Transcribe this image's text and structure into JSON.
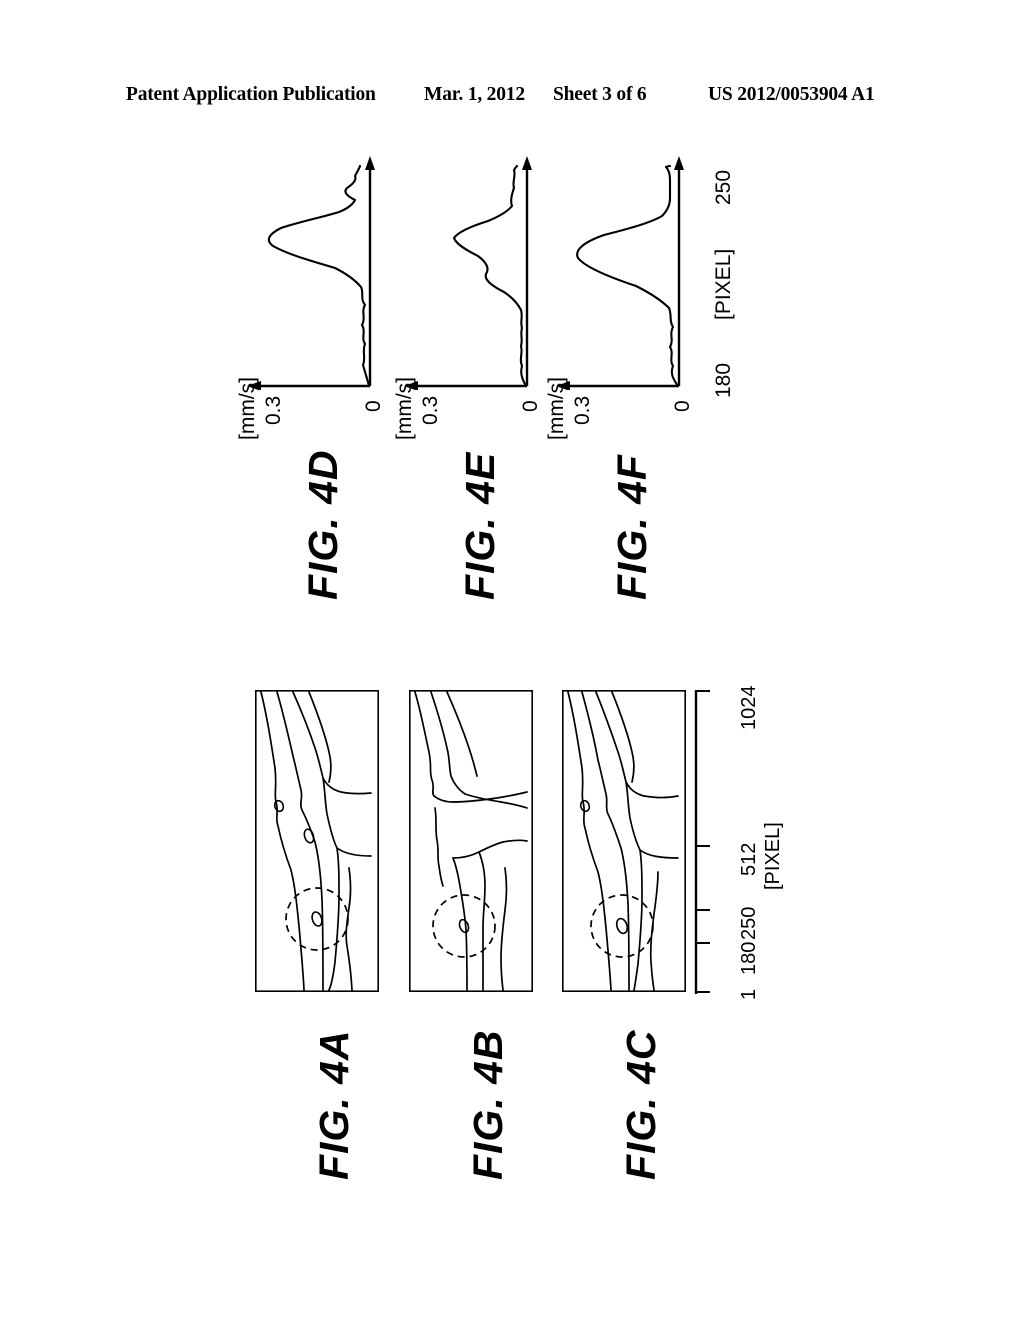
{
  "header": {
    "publication": "Patent Application Publication",
    "date": "Mar. 1, 2012",
    "sheet": "Sheet 3 of 6",
    "number": "US 2012/0053904 A1"
  },
  "figures": {
    "fig4a": {
      "label": "FIG. 4A"
    },
    "fig4b": {
      "label": "FIG. 4B"
    },
    "fig4c": {
      "label": "FIG. 4C"
    },
    "fig4d": {
      "label": "FIG. 4D"
    },
    "fig4e": {
      "label": "FIG. 4E"
    },
    "fig4f": {
      "label": "FIG. 4F"
    }
  },
  "image_panel_axis": {
    "unit_label": "[PIXEL]",
    "ticks": [
      "1",
      "180",
      "250",
      "512",
      "1024"
    ]
  },
  "plot_axis": {
    "y_unit_label": "[mm/s]",
    "y_max_label": "0.3",
    "y_zero_label": "0",
    "x_unit_label": "[PIXEL]",
    "x_min_label": "180",
    "x_max_label": "250"
  },
  "chart_data": [
    {
      "id": "fig4d",
      "type": "line",
      "title": "FIG. 4D",
      "xlabel": "[PIXEL]",
      "ylabel": "[mm/s]",
      "xlim": [
        180,
        250
      ],
      "ylim": [
        0,
        0.3
      ],
      "xticks": [
        180,
        250
      ],
      "yticks": [
        0,
        0.3
      ],
      "grid": false,
      "legend": "none",
      "orientation": "rotated-90",
      "x": [
        180,
        182,
        184,
        186,
        188,
        190,
        192,
        194,
        196,
        198,
        200,
        202,
        204,
        206,
        208,
        210,
        212,
        214,
        216,
        218,
        220,
        222,
        224,
        226,
        228,
        230,
        232,
        234,
        236,
        238,
        240,
        242,
        244,
        246,
        248,
        250
      ],
      "y": [
        0.004,
        0.01,
        0.016,
        0.012,
        0.02,
        0.016,
        0.024,
        0.018,
        0.026,
        0.02,
        0.028,
        0.022,
        0.03,
        0.026,
        0.034,
        0.03,
        0.044,
        0.06,
        0.11,
        0.195,
        0.258,
        0.282,
        0.27,
        0.232,
        0.176,
        0.12,
        0.082,
        0.062,
        0.05,
        0.058,
        0.072,
        0.066,
        0.052,
        0.04,
        0.034,
        0.04
      ]
    },
    {
      "id": "fig4e",
      "type": "line",
      "title": "FIG. 4E",
      "xlabel": "[PIXEL]",
      "ylabel": "[mm/s]",
      "xlim": [
        180,
        250
      ],
      "ylim": [
        0,
        0.3
      ],
      "xticks": [
        180,
        250
      ],
      "yticks": [
        0,
        0.3
      ],
      "grid": false,
      "legend": "none",
      "orientation": "rotated-90",
      "x": [
        180,
        182,
        184,
        186,
        188,
        190,
        192,
        194,
        196,
        198,
        200,
        202,
        204,
        206,
        208,
        210,
        212,
        214,
        216,
        218,
        220,
        222,
        224,
        226,
        228,
        230,
        232,
        234,
        236,
        238,
        240,
        242,
        244,
        246,
        248,
        250
      ],
      "y": [
        0.004,
        0.012,
        0.014,
        0.01,
        0.012,
        0.01,
        0.012,
        0.01,
        0.012,
        0.01,
        0.012,
        0.014,
        0.02,
        0.034,
        0.052,
        0.06,
        0.056,
        0.06,
        0.086,
        0.126,
        0.156,
        0.164,
        0.152,
        0.118,
        0.082,
        0.056,
        0.042,
        0.036,
        0.034,
        0.036,
        0.04,
        0.038,
        0.034,
        0.03,
        0.032,
        0.038
      ]
    },
    {
      "id": "fig4f",
      "type": "line",
      "title": "FIG. 4F",
      "xlabel": "[PIXEL]",
      "ylabel": "[mm/s]",
      "xlim": [
        180,
        250
      ],
      "ylim": [
        0,
        0.3
      ],
      "xticks": [
        180,
        250
      ],
      "yticks": [
        0,
        0.3
      ],
      "grid": false,
      "legend": "none",
      "orientation": "rotated-90",
      "x": [
        180,
        182,
        184,
        186,
        188,
        190,
        192,
        194,
        196,
        198,
        200,
        202,
        204,
        206,
        208,
        210,
        212,
        214,
        216,
        218,
        220,
        222,
        224,
        226,
        228,
        230,
        232,
        234,
        236,
        238,
        240,
        242,
        244,
        246,
        248,
        250
      ],
      "y": [
        0.004,
        0.014,
        0.02,
        0.014,
        0.022,
        0.018,
        0.026,
        0.02,
        0.028,
        0.022,
        0.03,
        0.028,
        0.038,
        0.052,
        0.09,
        0.16,
        0.232,
        0.268,
        0.26,
        0.212,
        0.148,
        0.092,
        0.056,
        0.038,
        0.03,
        0.026,
        0.024,
        0.022,
        0.022,
        0.022,
        0.022,
        0.022,
        0.022,
        0.022,
        0.024,
        0.04
      ]
    }
  ]
}
